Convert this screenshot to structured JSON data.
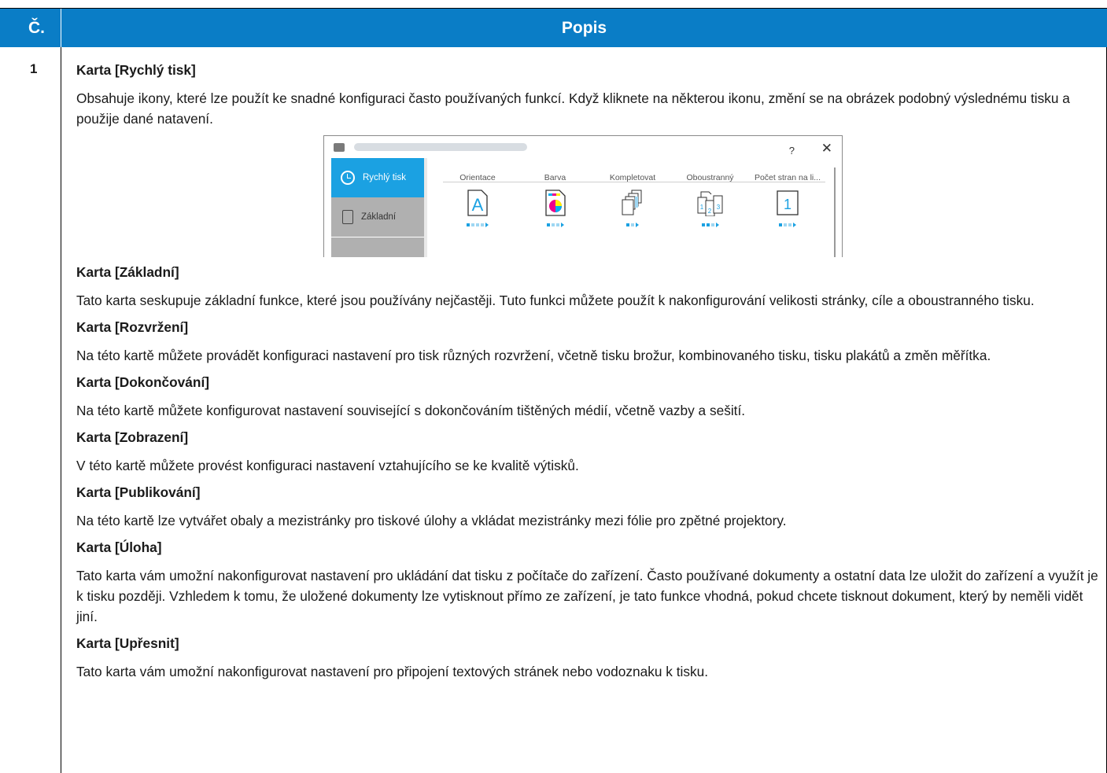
{
  "table": {
    "header_num": "Č.",
    "header_desc": "Popis",
    "row_num": "1"
  },
  "sections": [
    {
      "title": "Karta [Rychlý tisk]",
      "text": "Obsahuje ikony, které lze použít ke snadné konfiguraci často používaných funkcí. Když kliknete na některou ikonu, změní se na obrázek podobný výslednému tisku a použije dané natavení."
    },
    {
      "title": "Karta [Základní]",
      "text": "Tato karta seskupuje základní funkce, které jsou používány nejčastěji. Tuto funkci můžete použít k nakonfigurování velikosti stránky, cíle a oboustranného tisku."
    },
    {
      "title": "Karta [Rozvržení]",
      "text": "Na této kartě můžete provádět konfiguraci nastavení pro tisk různých rozvržení, včetně tisku brožur, kombinovaného tisku, tisku plakátů a změn měřítka."
    },
    {
      "title": "Karta [Dokončování]",
      "text": "Na této kartě můžete konfigurovat nastavení související s dokončováním tištěných médií, včetně vazby a sešití."
    },
    {
      "title": "Karta [Zobrazení]",
      "text": "V této kartě můžete provést konfiguraci nastavení vztahujícího se ke kvalitě výtisků."
    },
    {
      "title": "Karta [Publikování]",
      "text": "Na této kartě lze vytvářet obaly a mezistránky pro tiskové úlohy a vkládat mezistránky mezi fólie pro zpětné projektory."
    },
    {
      "title": "Karta [Úloha]",
      "text": "Tato karta vám umožní nakonfigurovat nastavení pro ukládání dat tisku z počítače do zařízení. Často používané dokumenty a ostatní data lze uložit do zařízení a využít je k tisku později. Vzhledem k tomu, že uložené dokumenty lze vytisknout přímo ze zařízení, je tato funkce vhodná, pokud chcete tisknout dokument, který by neměli vidět jiní."
    },
    {
      "title": "Karta [Upřesnit]",
      "text": "Tato karta vám umožní nakonfigurovat nastavení pro připojení textových stránek nebo vodoznaku k tisku."
    }
  ],
  "dialog": {
    "help": "?",
    "close": "✕",
    "sidebar": [
      "Rychlý tisk",
      "Základní"
    ],
    "columns": [
      "Orientace",
      "Barva",
      "Kompletovat",
      "Oboustranný",
      "Počet stran na li..."
    ],
    "orientation_glyph": "A",
    "nup_glyph": "1",
    "duplex_digits": [
      "1",
      "2",
      "3"
    ],
    "icon_names": [
      "orientation-icon",
      "color-icon",
      "collate-icon",
      "duplex-icon",
      "pages-per-sheet-icon"
    ],
    "accent_color": "#1ba1e2"
  },
  "colors": {
    "header_bg": "#0a7dc6",
    "text": "#1a1a1a"
  }
}
